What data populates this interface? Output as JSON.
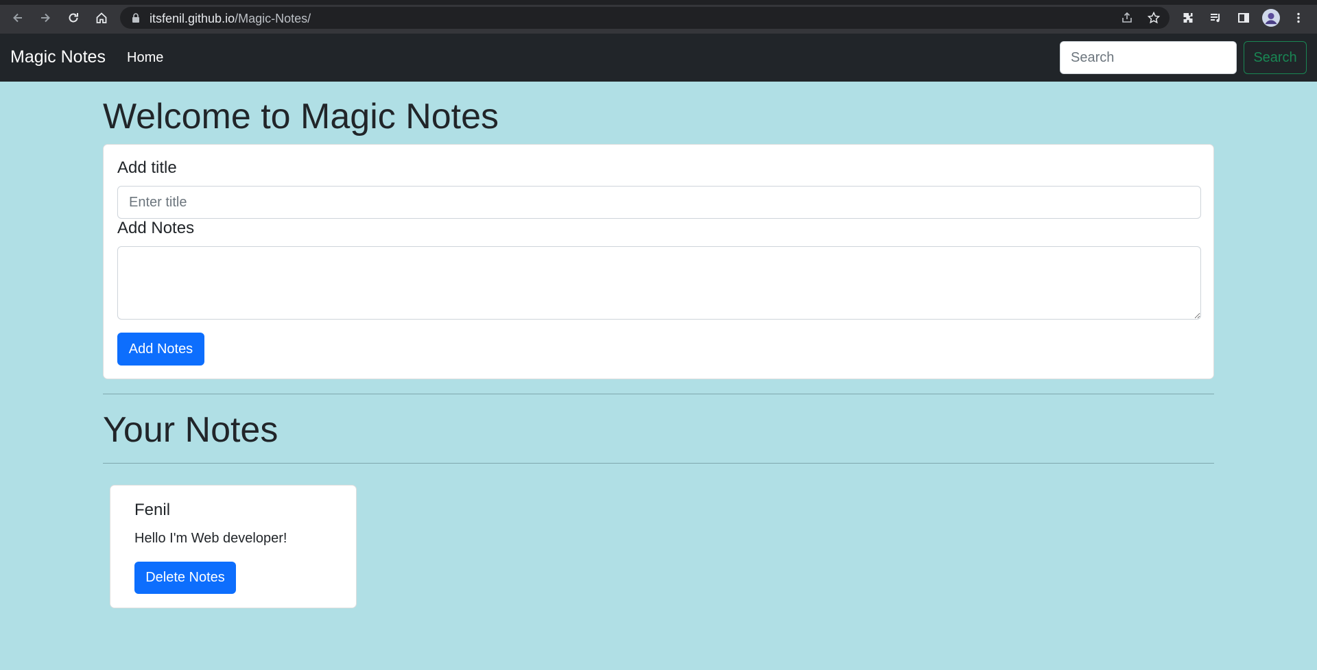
{
  "browser": {
    "url_host": "itsfenil.github.io",
    "url_path": "/Magic-Notes/"
  },
  "navbar": {
    "brand": "Magic Notes",
    "home": "Home",
    "search_placeholder": "Search",
    "search_button": "Search"
  },
  "main": {
    "welcome_heading": "Welcome to Magic Notes",
    "form": {
      "title_label": "Add title",
      "title_placeholder": "Enter title",
      "notes_label": "Add Notes",
      "add_button": "Add Notes"
    },
    "notes_heading": "Your Notes",
    "notes": [
      {
        "title": "Fenil",
        "text": "Hello I'm Web developer!",
        "delete_button": "Delete Notes"
      }
    ]
  },
  "colors": {
    "page_background": "#b0dfe5",
    "navbar": "#212529",
    "primary": "#0d6efd",
    "success": "#198754"
  }
}
